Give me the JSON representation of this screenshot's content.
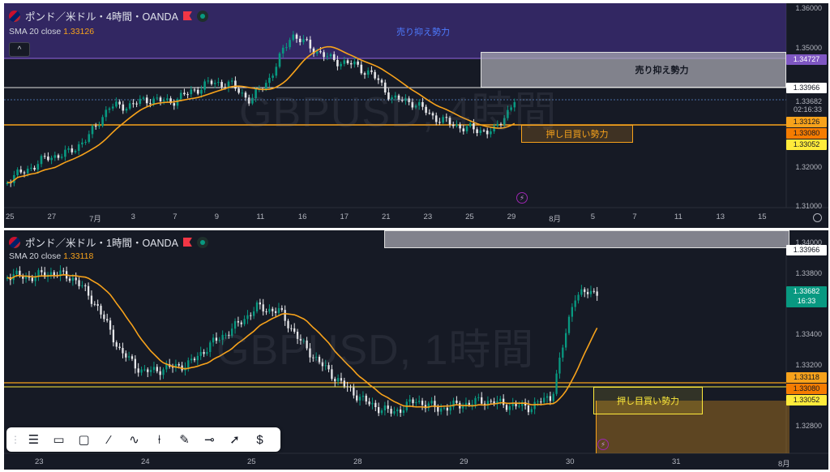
{
  "colors": {
    "up": "#089981",
    "down": "#e6e7ea",
    "sma": "#f7a21b",
    "resist": "#7e57c2",
    "support": "#f7a21b",
    "bg": "#161a25"
  },
  "top": {
    "title": "ポンド／米ドル・4時間・OANDA",
    "sma_label": "SMA 20 close",
    "sma_value": "1.33126",
    "watermark": "GBPUSD, 4時間",
    "zone_sell_small": "売り抑え勢力",
    "zone_sell": "売り抑え勢力",
    "zone_buy": "押し目買い勢力",
    "axis": [
      "1.36000",
      "1.35000",
      "1.33682",
      "1.32000",
      "1.31000"
    ],
    "tags": [
      {
        "text": "1.34727",
        "bg": "#7e57c2",
        "fg": "#ffffff"
      },
      {
        "text": "1.33966",
        "bg": "#ffffff",
        "fg": "#131722"
      },
      {
        "text": "1.33126",
        "bg": "#f7a21b",
        "fg": "#131722"
      },
      {
        "text": "1.33080",
        "bg": "#f57c00",
        "fg": "#131722"
      },
      {
        "text": "1.33052",
        "bg": "#ffeb3b",
        "fg": "#131722"
      }
    ],
    "countdown": "02:16:33",
    "xlabels": [
      "25",
      "27",
      "7月",
      "3",
      "7",
      "9",
      "11",
      "16",
      "17",
      "21",
      "23",
      "25",
      "29",
      "8月",
      "5",
      "7",
      "11",
      "13",
      "15"
    ]
  },
  "bottom": {
    "title": "ポンド／米ドル・1時間・OANDA",
    "sma_label": "SMA 20 close",
    "sma_value": "1.33118",
    "watermark": "GBPUSD, 1時間",
    "zone_buy": "押し目買い勢力",
    "axis": [
      "1.34000",
      "1.33800",
      "1.33400",
      "1.33200",
      "1.32800"
    ],
    "tags": [
      {
        "text": "1.33966",
        "bg": "#ffffff",
        "fg": "#131722"
      },
      {
        "text": "1.33682",
        "bg": "#089981",
        "fg": "#ffffff"
      },
      {
        "text": "1.33118",
        "bg": "#f7a21b",
        "fg": "#131722"
      },
      {
        "text": "1.33080",
        "bg": "#f57c00",
        "fg": "#131722"
      },
      {
        "text": "1.33052",
        "bg": "#ffeb3b",
        "fg": "#131722"
      }
    ],
    "countdown": "16:33",
    "xlabels": [
      "23",
      "24",
      "25",
      "28",
      "29",
      "30",
      "31",
      "8月"
    ]
  },
  "toolbar": [
    "drag-handle-icon",
    "lines-icon",
    "comment-icon",
    "rectangle-icon",
    "trendline-icon",
    "path-icon",
    "position-icon",
    "brush-icon",
    "horizontal-line-icon",
    "cursor-icon",
    "price-icon"
  ]
}
